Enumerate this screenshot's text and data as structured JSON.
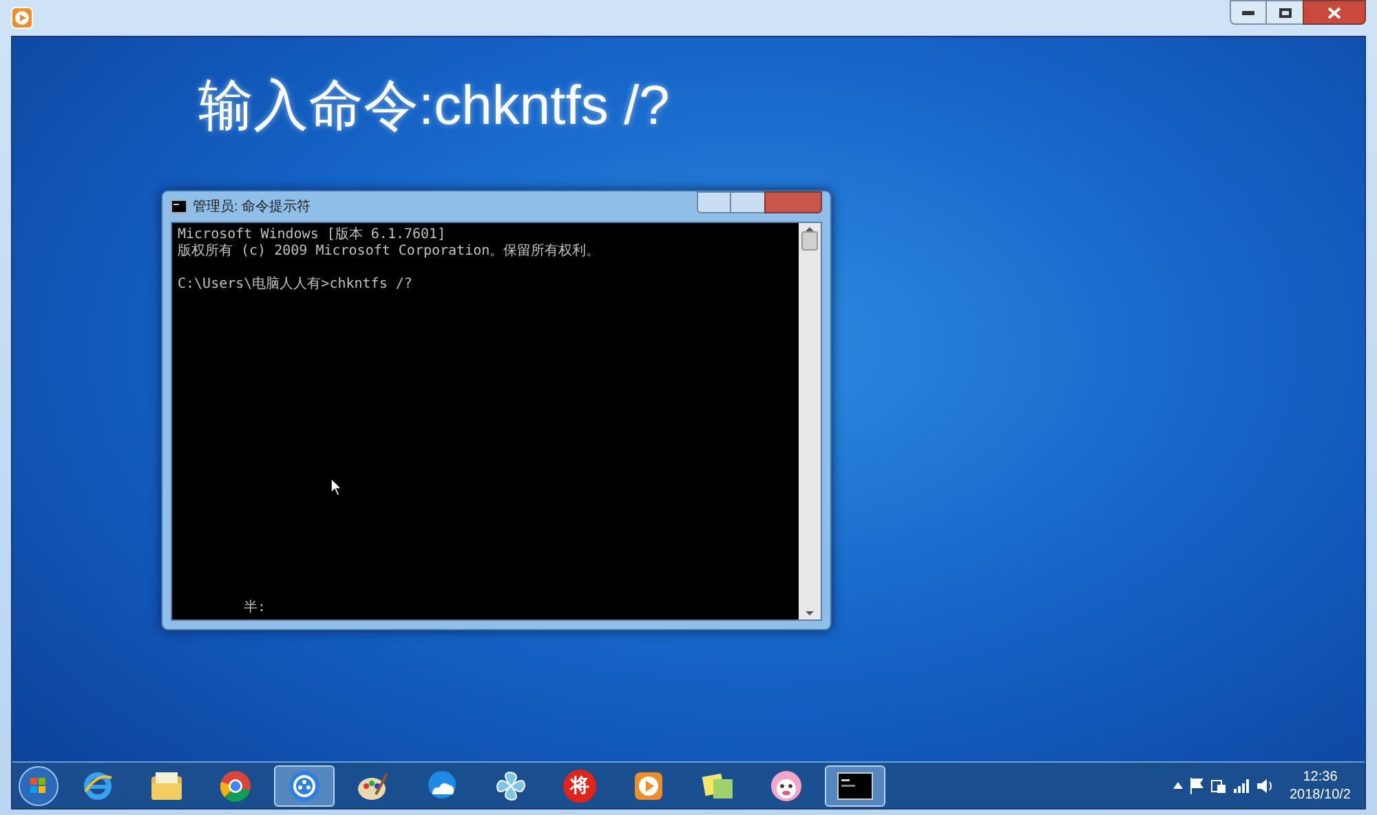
{
  "caption": "输入命令:chkntfs /?",
  "console": {
    "title": "管理员: 命令提示符",
    "blocks": [
      [
        "Microsoft Windows [版本 6.1.7601]",
        "版权所有 (c) 2009 Microsoft Corporation。保留所有权利。"
      ],
      [
        "C:\\Users\\电脑人人有>chkntfs /?"
      ]
    ],
    "ime": "半:"
  },
  "taskbar": {
    "apps": [
      {
        "kind": "ie",
        "selected": false
      },
      {
        "kind": "folder",
        "selected": false
      },
      {
        "kind": "chrome",
        "selected": false
      },
      {
        "kind": "dots",
        "selected": true
      },
      {
        "kind": "palette",
        "selected": false
      },
      {
        "kind": "cloud",
        "selected": false
      },
      {
        "kind": "pinwheel",
        "selected": false
      },
      {
        "kind": "badge",
        "label": "将",
        "selected": false
      },
      {
        "kind": "play",
        "selected": false
      },
      {
        "kind": "notes",
        "selected": false
      },
      {
        "kind": "face",
        "selected": false
      },
      {
        "kind": "terminal",
        "selected": true
      }
    ],
    "clock": {
      "time": "12:36",
      "date": "2018/10/2"
    }
  }
}
